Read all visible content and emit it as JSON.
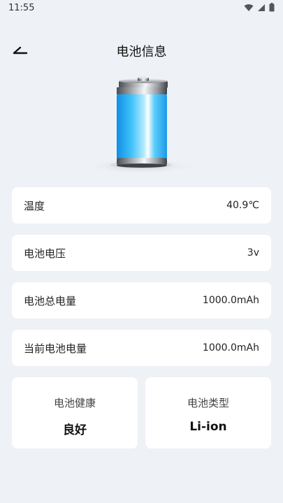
{
  "status_bar": {
    "time": "11:55",
    "icons": [
      "wifi-icon",
      "cellular-signal-icon",
      "battery-status-icon"
    ]
  },
  "header": {
    "title": "电池信息",
    "back_icon": "back-arrow-icon"
  },
  "battery_image": {
    "icon": "battery-full-icon",
    "fill_level": 1.0,
    "accent": "#2ab4f5"
  },
  "info_rows": [
    {
      "label": "温度",
      "value": "40.9℃"
    },
    {
      "label": "电池电压",
      "value": "3v"
    },
    {
      "label": "电池总电量",
      "value": "1000.0mAh"
    },
    {
      "label": "当前电池电量",
      "value": "1000.0mAh"
    }
  ],
  "tiles": [
    {
      "label": "电池健康",
      "value": "良好"
    },
    {
      "label": "电池类型",
      "value": "Li-ion"
    }
  ],
  "colors": {
    "background": "#eef1f6",
    "card": "#ffffff",
    "battery_accent": "#2ab4f5"
  }
}
